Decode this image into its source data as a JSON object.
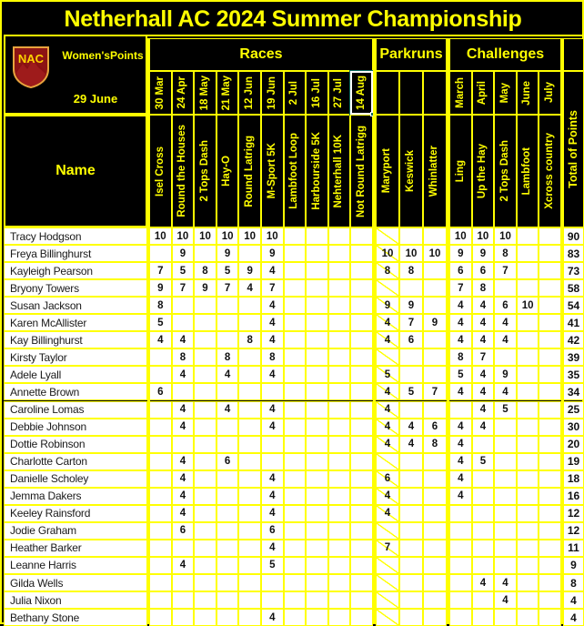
{
  "title": "Netherhall AC 2024 Summer Championship",
  "logo": {
    "text": "NAC",
    "shield_fill": "#8c1414",
    "shield_border": "#e8a33d",
    "alt": "netherhall-ac-logo"
  },
  "header": {
    "category_label": "Women'sPoints",
    "date_label": "29 June",
    "name_label": "Name",
    "groups": [
      {
        "label": "Races"
      },
      {
        "label": "Parkruns"
      },
      {
        "label": "Challenges"
      }
    ],
    "total_label": "Total of Points"
  },
  "columns": {
    "races": [
      {
        "date": "30 Mar",
        "name": "Isel Cross"
      },
      {
        "date": "24 Apr",
        "name": "Round the Houses"
      },
      {
        "date": "18 May",
        "name": "2 Tops Dash"
      },
      {
        "date": "21 May",
        "name": "Hay-O"
      },
      {
        "date": "12 Jun",
        "name": "Round Latrigg"
      },
      {
        "date": "19 Jun",
        "name": "M-Sport  5K"
      },
      {
        "date": "2 Jul",
        "name": "Lambfoot Loop"
      },
      {
        "date": "16 Jul",
        "name": "Harbourside 5K"
      },
      {
        "date": "27 Jul",
        "name": "Nehterhall 10K"
      },
      {
        "date": "14 Aug",
        "name": "Not Round Latrigg",
        "selected": true
      }
    ],
    "parkruns": [
      {
        "date": "",
        "name": "Maryport",
        "struck": true
      },
      {
        "date": "",
        "name": "Keswick"
      },
      {
        "date": "",
        "name": "Whinlatter"
      }
    ],
    "challenges": [
      {
        "date": "March",
        "name": "Ling"
      },
      {
        "date": "April",
        "name": "Up the Hay"
      },
      {
        "date": "May",
        "name": "2 Tops Dash"
      },
      {
        "date": "June",
        "name": "Lambfoot"
      },
      {
        "date": "July",
        "name": "Xcross country"
      }
    ]
  },
  "rows": [
    {
      "name": "Tracy Hodgson",
      "races": [
        "10",
        "10",
        "10",
        "10",
        "10",
        "10",
        "",
        "",
        "",
        ""
      ],
      "parkruns": [
        "",
        "",
        ""
      ],
      "challenges": [
        "10",
        "10",
        "10",
        "",
        ""
      ],
      "total": "90"
    },
    {
      "name": "Freya Billinghurst",
      "races": [
        "",
        "9",
        "",
        "9",
        "",
        "9",
        "",
        "",
        "",
        ""
      ],
      "parkruns": [
        "10",
        "10",
        "10"
      ],
      "challenges": [
        "9",
        "9",
        "8",
        "",
        ""
      ],
      "total": "83"
    },
    {
      "name": "Kayleigh Pearson",
      "races": [
        "7",
        "5",
        "8",
        "5",
        "9",
        "4",
        "",
        "",
        "",
        ""
      ],
      "parkruns": [
        "8",
        "8",
        ""
      ],
      "challenges": [
        "6",
        "6",
        "7",
        "",
        ""
      ],
      "total": "73"
    },
    {
      "name": "Bryony Towers",
      "races": [
        "9",
        "7",
        "9",
        "7",
        "4",
        "7",
        "",
        "",
        "",
        ""
      ],
      "parkruns": [
        "",
        "",
        ""
      ],
      "challenges": [
        "7",
        "8",
        "",
        "",
        ""
      ],
      "total": "58"
    },
    {
      "name": "Susan Jackson",
      "races": [
        "8",
        "",
        "",
        "",
        "",
        "4",
        "",
        "",
        "",
        ""
      ],
      "parkruns": [
        "9",
        "9",
        ""
      ],
      "challenges": [
        "4",
        "4",
        "6",
        "10",
        ""
      ],
      "total": "54"
    },
    {
      "name": "Karen McAllister",
      "races": [
        "5",
        "",
        "",
        "",
        "",
        "4",
        "",
        "",
        "",
        ""
      ],
      "parkruns": [
        "4",
        "7",
        "9"
      ],
      "challenges": [
        "4",
        "4",
        "4",
        "",
        ""
      ],
      "total": "41"
    },
    {
      "name": "Kay Billinghurst",
      "races": [
        "4",
        "4",
        "",
        "",
        "8",
        "4",
        "",
        "",
        "",
        ""
      ],
      "parkruns": [
        "4",
        "6",
        ""
      ],
      "challenges": [
        "4",
        "4",
        "4",
        "",
        ""
      ],
      "total": "42"
    },
    {
      "name": "Kirsty Taylor",
      "races": [
        "",
        "8",
        "",
        "8",
        "",
        "8",
        "",
        "",
        "",
        ""
      ],
      "parkruns": [
        "",
        "",
        ""
      ],
      "challenges": [
        "8",
        "7",
        "",
        "",
        ""
      ],
      "total": "39"
    },
    {
      "name": "Adele Lyall",
      "races": [
        "",
        "4",
        "",
        "4",
        "",
        "4",
        "",
        "",
        "",
        ""
      ],
      "parkruns": [
        "5",
        "",
        ""
      ],
      "challenges": [
        "5",
        "4",
        "9",
        "",
        ""
      ],
      "total": "35"
    },
    {
      "name": "Annette Brown",
      "races": [
        "6",
        "",
        "",
        "",
        "",
        "",
        "",
        "",
        "",
        ""
      ],
      "parkruns": [
        "4",
        "5",
        "7"
      ],
      "challenges": [
        "4",
        "4",
        "4",
        "",
        ""
      ],
      "total": "34"
    },
    {
      "name": "Caroline Lomas",
      "races": [
        "",
        "4",
        "",
        "4",
        "",
        "4",
        "",
        "",
        "",
        ""
      ],
      "parkruns": [
        "4",
        "",
        ""
      ],
      "challenges": [
        "",
        "4",
        "5",
        "",
        ""
      ],
      "total": "25"
    },
    {
      "name": "Debbie Johnson",
      "races": [
        "",
        "4",
        "",
        "",
        "",
        "4",
        "",
        "",
        "",
        ""
      ],
      "parkruns": [
        "4",
        "4",
        "6"
      ],
      "challenges": [
        "4",
        "4",
        "",
        "",
        ""
      ],
      "total": "30"
    },
    {
      "name": "Dottie Robinson",
      "races": [
        "",
        "",
        "",
        "",
        "",
        "",
        "",
        "",
        "",
        ""
      ],
      "parkruns": [
        "4",
        "4",
        "8"
      ],
      "challenges": [
        "4",
        "",
        "",
        "",
        ""
      ],
      "total": "20"
    },
    {
      "name": "Charlotte Carton",
      "races": [
        "",
        "4",
        "",
        "6",
        "",
        "",
        "",
        "",
        "",
        ""
      ],
      "parkruns": [
        "",
        "",
        ""
      ],
      "challenges": [
        "4",
        "5",
        "",
        "",
        ""
      ],
      "total": "19"
    },
    {
      "name": "Danielle Scholey",
      "races": [
        "",
        "4",
        "",
        "",
        "",
        "4",
        "",
        "",
        "",
        ""
      ],
      "parkruns": [
        "6",
        "",
        ""
      ],
      "challenges": [
        "4",
        "",
        "",
        "",
        ""
      ],
      "total": "18"
    },
    {
      "name": "Jemma Dakers",
      "races": [
        "",
        "4",
        "",
        "",
        "",
        "4",
        "",
        "",
        "",
        ""
      ],
      "parkruns": [
        "4",
        "",
        ""
      ],
      "challenges": [
        "4",
        "",
        "",
        "",
        ""
      ],
      "total": "16"
    },
    {
      "name": "Keeley Rainsford",
      "races": [
        "",
        "4",
        "",
        "",
        "",
        "4",
        "",
        "",
        "",
        ""
      ],
      "parkruns": [
        "4",
        "",
        ""
      ],
      "challenges": [
        "",
        "",
        "",
        "",
        ""
      ],
      "total": "12"
    },
    {
      "name": "Jodie Graham",
      "races": [
        "",
        "6",
        "",
        "",
        "",
        "6",
        "",
        "",
        "",
        ""
      ],
      "parkruns": [
        "",
        "",
        ""
      ],
      "challenges": [
        "",
        "",
        "",
        "",
        ""
      ],
      "total": "12"
    },
    {
      "name": "Heather Barker",
      "races": [
        "",
        "",
        "",
        "",
        "",
        "4",
        "",
        "",
        "",
        ""
      ],
      "parkruns": [
        "7",
        "",
        ""
      ],
      "challenges": [
        "",
        "",
        "",
        "",
        ""
      ],
      "total": "11"
    },
    {
      "name": "Leanne Harris",
      "races": [
        "",
        "4",
        "",
        "",
        "",
        "5",
        "",
        "",
        "",
        ""
      ],
      "parkruns": [
        "",
        "",
        ""
      ],
      "challenges": [
        "",
        "",
        "",
        "",
        ""
      ],
      "total": "9"
    },
    {
      "name": "Gilda Wells",
      "races": [
        "",
        "",
        "",
        "",
        "",
        "",
        "",
        "",
        "",
        ""
      ],
      "parkruns": [
        "",
        "",
        ""
      ],
      "challenges": [
        "",
        "4",
        "4",
        "",
        ""
      ],
      "total": "8"
    },
    {
      "name": "Julia Nixon",
      "races": [
        "",
        "",
        "",
        "",
        "",
        "",
        "",
        "",
        "",
        ""
      ],
      "parkruns": [
        "",
        "",
        ""
      ],
      "challenges": [
        "",
        "",
        "4",
        "",
        ""
      ],
      "total": "4"
    },
    {
      "name": "Bethany Stone",
      "races": [
        "",
        "",
        "",
        "",
        "",
        "4",
        "",
        "",
        "",
        ""
      ],
      "parkruns": [
        "",
        "",
        ""
      ],
      "challenges": [
        "",
        "",
        "",
        "",
        ""
      ],
      "total": "4"
    }
  ],
  "colors": {
    "grid": "#ffff00",
    "background": "#000000",
    "data_bg": "#ffffff",
    "text_dark": "#111111",
    "selection": "#ffffff"
  }
}
